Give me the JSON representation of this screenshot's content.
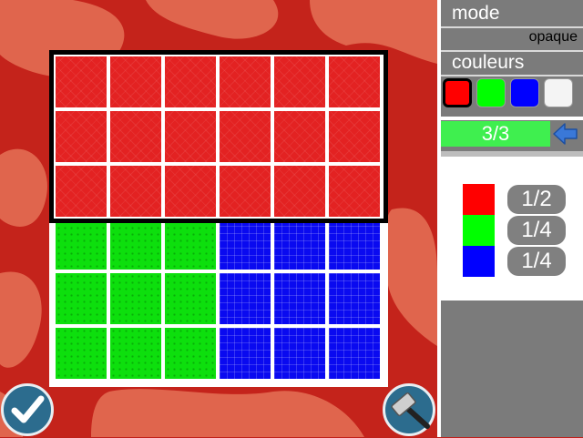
{
  "panel": {
    "mode_label": "mode",
    "mode_value": "opaque",
    "colors_label": "couleurs",
    "counter": "3/3"
  },
  "palette": [
    {
      "name": "red",
      "color": "#ff0000",
      "selected": true
    },
    {
      "name": "green",
      "color": "#00ff00",
      "selected": false
    },
    {
      "name": "blue",
      "color": "#0000ff",
      "selected": false
    },
    {
      "name": "white",
      "color": "#f4f4f4",
      "selected": false
    }
  ],
  "legend": [
    {
      "color": "#ff0000",
      "fraction": "1/2"
    },
    {
      "color": "#00ff00",
      "fraction": "1/4"
    },
    {
      "color": "#0000ff",
      "fraction": "1/4"
    }
  ],
  "grid": {
    "rows": [
      [
        "red",
        "red",
        "red",
        "red",
        "red",
        "red"
      ],
      [
        "red",
        "red",
        "red",
        "red",
        "red",
        "red"
      ],
      [
        "red",
        "red",
        "red",
        "red",
        "red",
        "red"
      ],
      [
        "green",
        "green",
        "green",
        "blue",
        "blue",
        "blue"
      ],
      [
        "green",
        "green",
        "green",
        "blue",
        "blue",
        "blue"
      ],
      [
        "green",
        "green",
        "green",
        "blue",
        "blue",
        "blue"
      ]
    ]
  },
  "icons": {
    "validate": "checkmark-icon",
    "tool": "hammer-icon",
    "back": "back-arrow-icon"
  }
}
